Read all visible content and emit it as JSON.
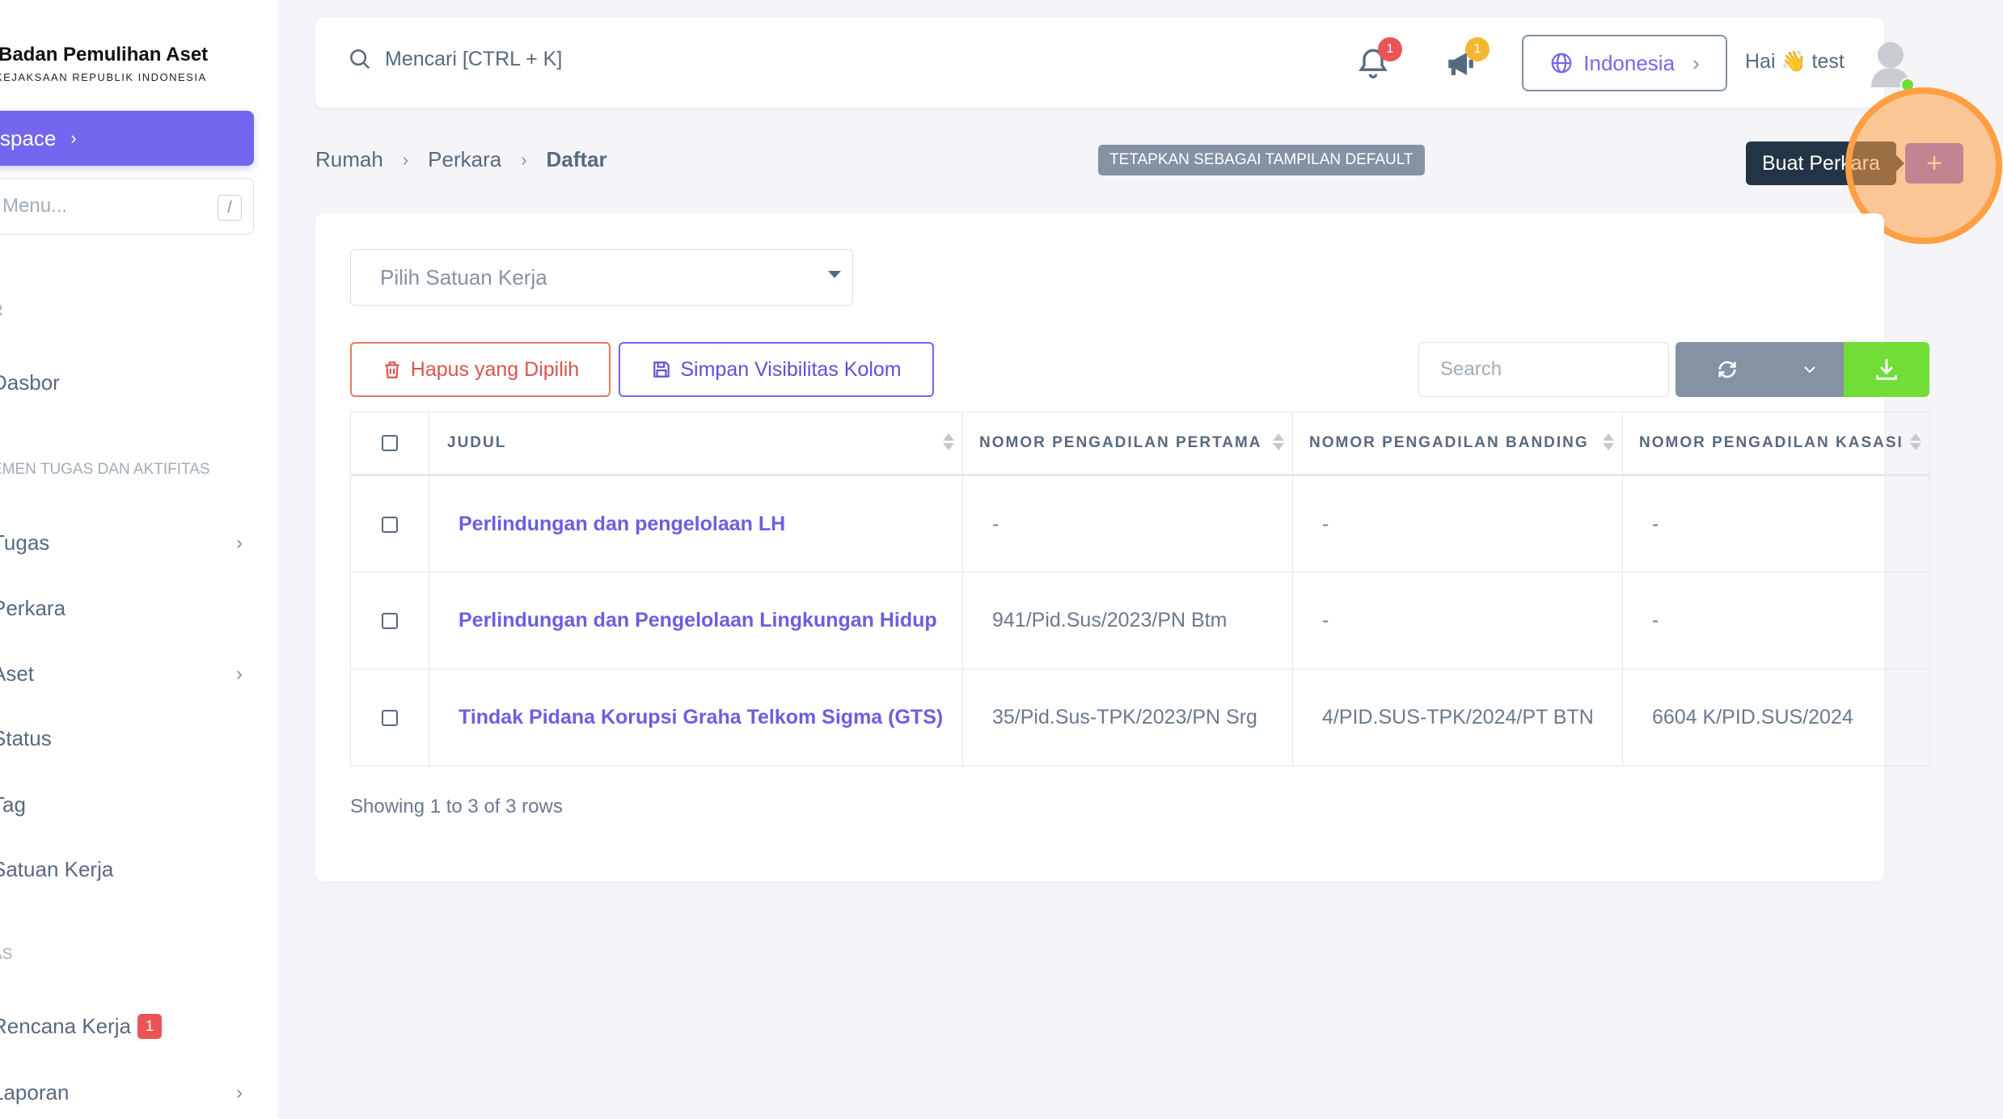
{
  "brand": {
    "title": "Badan Pemulihan Aset",
    "subtitle": "KEJAKSAAN REPUBLIK INDONESIA"
  },
  "sidebar": {
    "workspace_label": "space",
    "menu_search_placeholder": "Menu...",
    "menu_search_key": "/",
    "headers": [
      "R",
      "EMEN TUGAS DAN AKTIFITAS",
      "AS"
    ],
    "items": [
      {
        "label": "Dasbor"
      },
      {
        "label": "Tugas"
      },
      {
        "label": "Perkara"
      },
      {
        "label": "Aset"
      },
      {
        "label": "Status"
      },
      {
        "label": "Tag"
      },
      {
        "label": "Satuan Kerja"
      },
      {
        "label": "Rencana Kerja",
        "badge": "1"
      },
      {
        "label": "Laporan"
      }
    ]
  },
  "topbar": {
    "search_placeholder": "Mencari [CTRL + K]",
    "notifications_count": "1",
    "announcements_count": "1",
    "language": "Indonesia",
    "greeting": "Hai 👋 test"
  },
  "breadcrumb": {
    "items": [
      "Rumah",
      "Perkara",
      "Daftar"
    ]
  },
  "actions": {
    "set_default_view": "TETAPKAN SEBAGAI TAMPILAN DEFAULT",
    "create_tooltip": "Buat Perkara",
    "add_symbol": "+"
  },
  "filters": {
    "unit_select_placeholder": "Pilih Satuan Kerja",
    "delete_selected": "Hapus yang Dipilih",
    "save_visibility": "Simpan Visibilitas Kolom",
    "table_search_placeholder": "Search"
  },
  "table": {
    "columns": [
      "JUDUL",
      "NOMOR PENGADILAN PERTAMA",
      "NOMOR PENGADILAN BANDING",
      "NOMOR PENGADILAN KASASI"
    ],
    "rows": [
      [
        "Perlindungan dan pengelolaan LH",
        "-",
        "-",
        "-"
      ],
      [
        "Perlindungan dan Pengelolaan Lingkungan Hidup",
        "941/Pid.Sus/2023/PN Btm",
        "-",
        "-"
      ],
      [
        "Tindak Pidana Korupsi Graha Telkom Sigma (GTS)",
        "35/Pid.Sus-TPK/2023/PN Srg",
        "4/PID.SUS-TPK/2024/PT BTN",
        "6604 K/PID.SUS/2024"
      ]
    ],
    "footer": "Showing 1 to 3 of 3 rows"
  },
  "colors": {
    "primary": "#7367f0",
    "danger": "#ea5455",
    "warning": "#ff9f43",
    "success": "#71dd37",
    "secondary": "#8592a3"
  }
}
